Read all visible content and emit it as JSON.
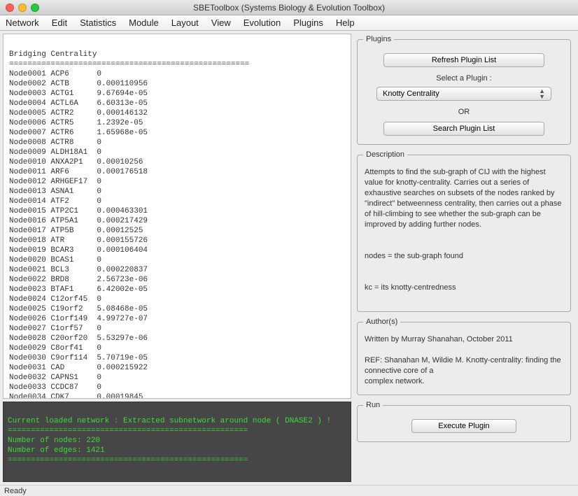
{
  "window": {
    "title": "SBEToolbox (Systems Biology & Evolution Toolbox)"
  },
  "menu": [
    "Network",
    "Edit",
    "Statistics",
    "Module",
    "Layout",
    "View",
    "Evolution",
    "Plugins",
    "Help"
  ],
  "data_header": "Bridging Centrality",
  "data_sep": "====================================================",
  "rows": [
    [
      "Node0001",
      "ACP6",
      "0"
    ],
    [
      "Node0002",
      "ACTB",
      "0.000110956"
    ],
    [
      "Node0003",
      "ACTG1",
      "9.67694e-05"
    ],
    [
      "Node0004",
      "ACTL6A",
      "6.60313e-05"
    ],
    [
      "Node0005",
      "ACTR2",
      "0.000146132"
    ],
    [
      "Node0006",
      "ACTR5",
      "1.2392e-05"
    ],
    [
      "Node0007",
      "ACTR6",
      "1.65968e-05"
    ],
    [
      "Node0008",
      "ACTR8",
      "0"
    ],
    [
      "Node0009",
      "ALDH18A1",
      "0"
    ],
    [
      "Node0010",
      "ANXA2P1",
      "0.00010256"
    ],
    [
      "Node0011",
      "ARF6",
      "0.000176518"
    ],
    [
      "Node0012",
      "ARHGEF17",
      "0"
    ],
    [
      "Node0013",
      "ASNA1",
      "0"
    ],
    [
      "Node0014",
      "ATF2",
      "0"
    ],
    [
      "Node0015",
      "ATP2C1",
      "0.000463301"
    ],
    [
      "Node0016",
      "ATP5A1",
      "0.000217429"
    ],
    [
      "Node0017",
      "ATP5B",
      "0.00012525"
    ],
    [
      "Node0018",
      "ATR",
      "0.000155726"
    ],
    [
      "Node0019",
      "BCAR3",
      "0.000106404"
    ],
    [
      "Node0020",
      "BCAS1",
      "0"
    ],
    [
      "Node0021",
      "BCL3",
      "0.000220837"
    ],
    [
      "Node0022",
      "BRD8",
      "2.56723e-06"
    ],
    [
      "Node0023",
      "BTAF1",
      "6.42002e-05"
    ],
    [
      "Node0024",
      "C12orf45",
      "0"
    ],
    [
      "Node0025",
      "C19orf2",
      "5.08468e-05"
    ],
    [
      "Node0026",
      "C1orf149",
      "4.99727e-07"
    ],
    [
      "Node0027",
      "C1orf57",
      "0"
    ],
    [
      "Node0028",
      "C20orf20",
      "5.53297e-06"
    ],
    [
      "Node0029",
      "C8orf41",
      "0"
    ],
    [
      "Node0030",
      "C9orf114",
      "5.70719e-05"
    ],
    [
      "Node0031",
      "CAD",
      "0.000215922"
    ],
    [
      "Node0032",
      "CAPNS1",
      "0"
    ],
    [
      "Node0033",
      "CCDC87",
      "0"
    ],
    [
      "Node0034",
      "CDK7",
      "0.00019845"
    ]
  ],
  "console": {
    "line1": "Current loaded network : Extracted subnetwork around node ( DNASE2 ) !",
    "sep": "====================================================",
    "line2": "Number of nodes: 220",
    "line3": "Number of edges: 1421"
  },
  "plugins": {
    "legend": "Plugins",
    "refresh": "Refresh Plugin List",
    "select_label": "Select a Plugin  :",
    "selected": "Knotty Centrality",
    "or": "OR",
    "search": "Search Plugin List"
  },
  "description": {
    "legend": "Description",
    "p1": "Attempts to find the sub-graph of CIJ with the highest value for knotty-centrality. Carries out a series of exhaustive searches on subsets of the nodes ranked by \"indirect\" betweenness centrality, then carries out a phase of hill-climbing to see whether the sub-graph can be improved by adding further nodes.",
    "p2": "nodes = the sub-graph found",
    "p3": "kc = its knotty-centredness"
  },
  "author": {
    "legend": "Author(s)",
    "p1": "Written by Murray Shanahan, October 2011",
    "p2": "REF: Shanahan M, Wildie M. Knotty-centrality: finding the connective core of a",
    "p3": "complex network."
  },
  "run": {
    "legend": "Run",
    "execute": "Execute Plugin"
  },
  "status": "Ready"
}
